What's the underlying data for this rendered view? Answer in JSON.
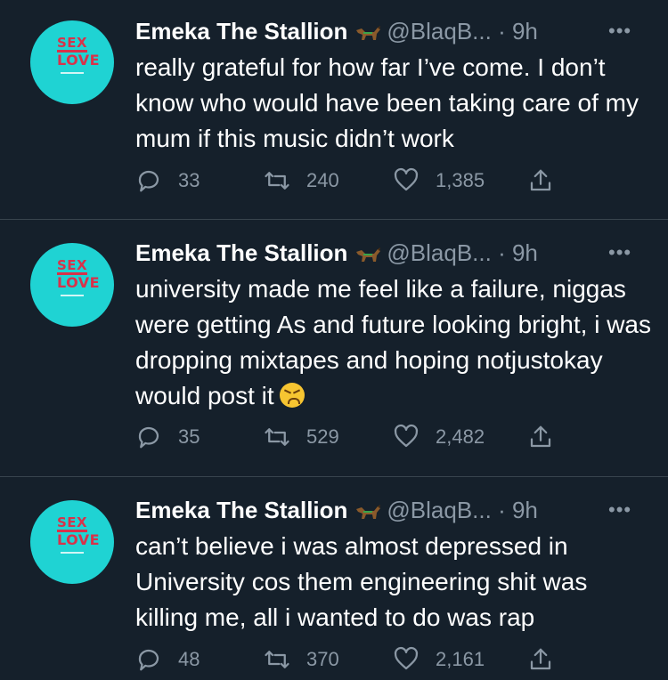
{
  "tweets": [
    {
      "author": "Emeka The Stallion",
      "handle": "@BlaqB...",
      "time": "· 9h",
      "more": "•••",
      "text": "really grateful for how far I’ve come. I don’t know who would have been taking care of my mum if this music didn’t work",
      "emoji": "",
      "replies": "33",
      "retweets": "240",
      "likes": "1,385"
    },
    {
      "author": "Emeka The Stallion",
      "handle": "@BlaqB...",
      "time": "· 9h",
      "more": "•••",
      "text": "university made me feel like a failure, niggas were getting As and future looking bright, i was dropping mixtapes and hoping notjustokay would post it",
      "emoji": "persevering-face-emoji",
      "replies": "35",
      "retweets": "529",
      "likes": "2,482"
    },
    {
      "author": "Emeka The Stallion",
      "handle": "@BlaqB...",
      "time": "· 9h",
      "more": "•••",
      "text": "can’t believe i was almost depressed in University cos them engineering shit was killing me, all i wanted to do was rap",
      "emoji": "",
      "replies": "48",
      "retweets": "370",
      "likes": "2,161"
    }
  ],
  "avatar": {
    "logo_line1": "SEX",
    "logo_line2": "LOVE"
  },
  "colors": {
    "background": "#15202b",
    "secondary_text": "#8b98a5",
    "divider": "#38444d",
    "avatar_bg": "#1fd3d3",
    "logo_red": "#d8324a"
  },
  "icons": [
    "reply-icon",
    "retweet-icon",
    "like-icon",
    "share-icon",
    "horse-emoji-icon",
    "more-icon"
  ]
}
